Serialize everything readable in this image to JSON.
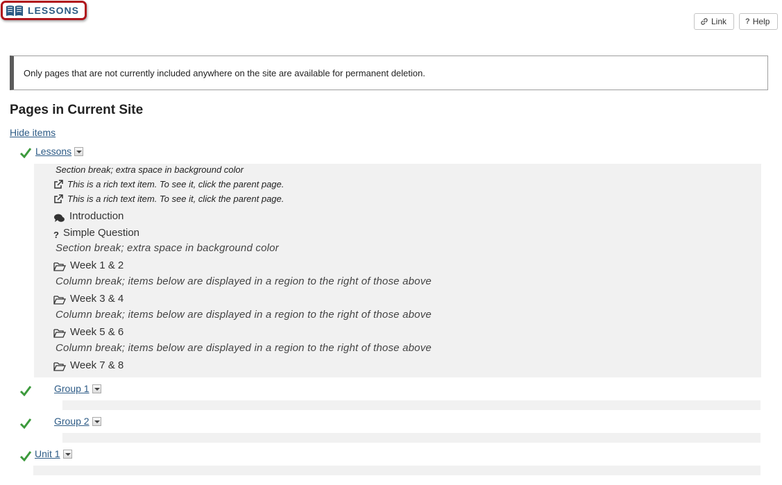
{
  "tool": {
    "title": "LESSONS",
    "icon": "book-icon"
  },
  "toolbar": {
    "link_label": "Link",
    "help_label": "Help",
    "help_icon_text": "?"
  },
  "notice": {
    "text": "Only pages that are not currently included anywhere on the site are available for permanent deletion."
  },
  "heading": "Pages in Current Site",
  "hide_items_label": "Hide items",
  "pages": [
    {
      "name": "Lessons",
      "items": [
        {
          "type": "section-break",
          "text": "Section break; extra space in background color"
        },
        {
          "type": "rich-text",
          "icon": "external-link-icon",
          "text": "This is a rich text item. To see it, click the parent page."
        },
        {
          "type": "rich-text",
          "icon": "external-link-icon",
          "text": "This is a rich text item. To see it, click the parent page."
        },
        {
          "type": "forum",
          "icon": "comments-icon",
          "text": "Introduction"
        },
        {
          "type": "question",
          "icon": "question-icon",
          "text": "Simple Question"
        },
        {
          "type": "section-break",
          "text": "Section break; extra space in background color"
        },
        {
          "type": "subpage",
          "icon": "folder-open-icon",
          "text": "Week 1 & 2"
        },
        {
          "type": "column-break",
          "text": "Column break; items below are displayed in a region to the right of those above"
        },
        {
          "type": "subpage",
          "icon": "folder-open-icon",
          "text": "Week 3 & 4"
        },
        {
          "type": "column-break",
          "text": "Column break; items below are displayed in a region to the right of those above"
        },
        {
          "type": "subpage",
          "icon": "folder-open-icon",
          "text": "Week 5 & 6"
        },
        {
          "type": "column-break",
          "text": "Column break; items below are displayed in a region to the right of those above"
        },
        {
          "type": "subpage",
          "icon": "folder-open-icon",
          "text": "Week 7 & 8"
        }
      ]
    },
    {
      "name": "Group 1"
    },
    {
      "name": "Group 2"
    },
    {
      "name": "Unit 1"
    }
  ],
  "colors": {
    "accent": "#2d5b86",
    "check": "#3c9a3c",
    "highlight_border": "#b0151c",
    "panel_bg": "#f1f1f1"
  }
}
